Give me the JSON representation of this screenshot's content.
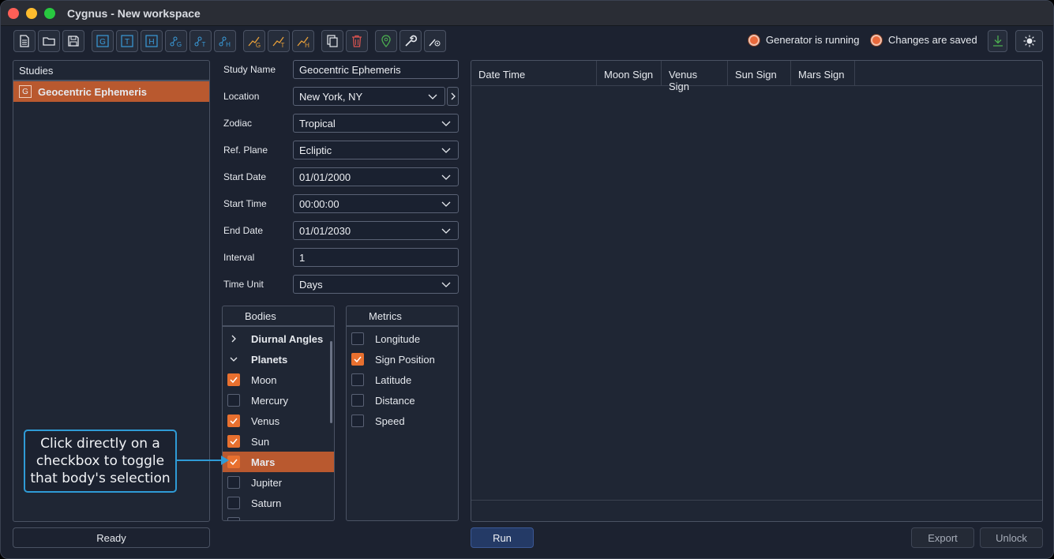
{
  "window": {
    "title": "Cygnus - New workspace"
  },
  "toolbar": {
    "buttons": [
      {
        "name": "new-file-icon"
      },
      {
        "name": "open-folder-icon"
      },
      {
        "name": "save-icon"
      },
      {
        "name": "g-study-icon",
        "letter": "G"
      },
      {
        "name": "t-study-icon",
        "letter": "T"
      },
      {
        "name": "h-study-icon",
        "letter": "H"
      },
      {
        "name": "g-graph-icon"
      },
      {
        "name": "t-graph-icon"
      },
      {
        "name": "h-graph-icon"
      },
      {
        "name": "g-chart-icon"
      },
      {
        "name": "t-chart-icon"
      },
      {
        "name": "h-chart-icon"
      },
      {
        "name": "copy-icon"
      },
      {
        "name": "delete-icon"
      },
      {
        "name": "location-pin-icon"
      },
      {
        "name": "wrench-icon"
      },
      {
        "name": "graph-settings-icon"
      }
    ],
    "status_generator": "Generator is running",
    "status_saved": "Changes are saved",
    "colors": {
      "accent": "#e8702f",
      "selected": "#b9592f",
      "blue_icon": "#3a9bd9",
      "orange_icon": "#e8a03a",
      "green_icon": "#4caf50",
      "red_icon": "#d9534f"
    }
  },
  "studies": {
    "header": "Studies",
    "items": [
      {
        "label": "Geocentric Ephemeris",
        "badge": "G"
      }
    ]
  },
  "status_bar": {
    "ready": "Ready"
  },
  "form": {
    "study_name": {
      "label": "Study Name",
      "value": "Geocentric Ephemeris"
    },
    "location": {
      "label": "Location",
      "value": "New York, NY"
    },
    "zodiac": {
      "label": "Zodiac",
      "value": "Tropical"
    },
    "ref_plane": {
      "label": "Ref. Plane",
      "value": "Ecliptic"
    },
    "start_date": {
      "label": "Start Date",
      "value": "01/01/2000"
    },
    "start_time": {
      "label": "Start Time",
      "value": "00:00:00"
    },
    "end_date": {
      "label": "End Date",
      "value": "01/01/2030"
    },
    "interval": {
      "label": "Interval",
      "value": "1"
    },
    "time_unit": {
      "label": "Time Unit",
      "value": "Days"
    }
  },
  "bodies": {
    "header": "Bodies",
    "groups": [
      {
        "label": "Diurnal Angles",
        "expanded": false
      },
      {
        "label": "Planets",
        "expanded": true
      }
    ],
    "items": [
      {
        "label": "Moon",
        "checked": true
      },
      {
        "label": "Mercury",
        "checked": false
      },
      {
        "label": "Venus",
        "checked": true
      },
      {
        "label": "Sun",
        "checked": true
      },
      {
        "label": "Mars",
        "checked": true,
        "selected": true
      },
      {
        "label": "Jupiter",
        "checked": false
      },
      {
        "label": "Saturn",
        "checked": false
      }
    ]
  },
  "metrics": {
    "header": "Metrics",
    "items": [
      {
        "label": "Longitude",
        "checked": false
      },
      {
        "label": "Sign Position",
        "checked": true
      },
      {
        "label": "Latitude",
        "checked": false
      },
      {
        "label": "Distance",
        "checked": false
      },
      {
        "label": "Speed",
        "checked": false
      }
    ]
  },
  "results_table": {
    "columns": [
      "Date Time",
      "Moon Sign",
      "Venus Sign",
      "Sun Sign",
      "Mars Sign"
    ]
  },
  "actions": {
    "run": "Run",
    "export": "Export",
    "unlock": "Unlock"
  },
  "callout": {
    "text": "Click directly on a checkbox to toggle that body's selection"
  }
}
